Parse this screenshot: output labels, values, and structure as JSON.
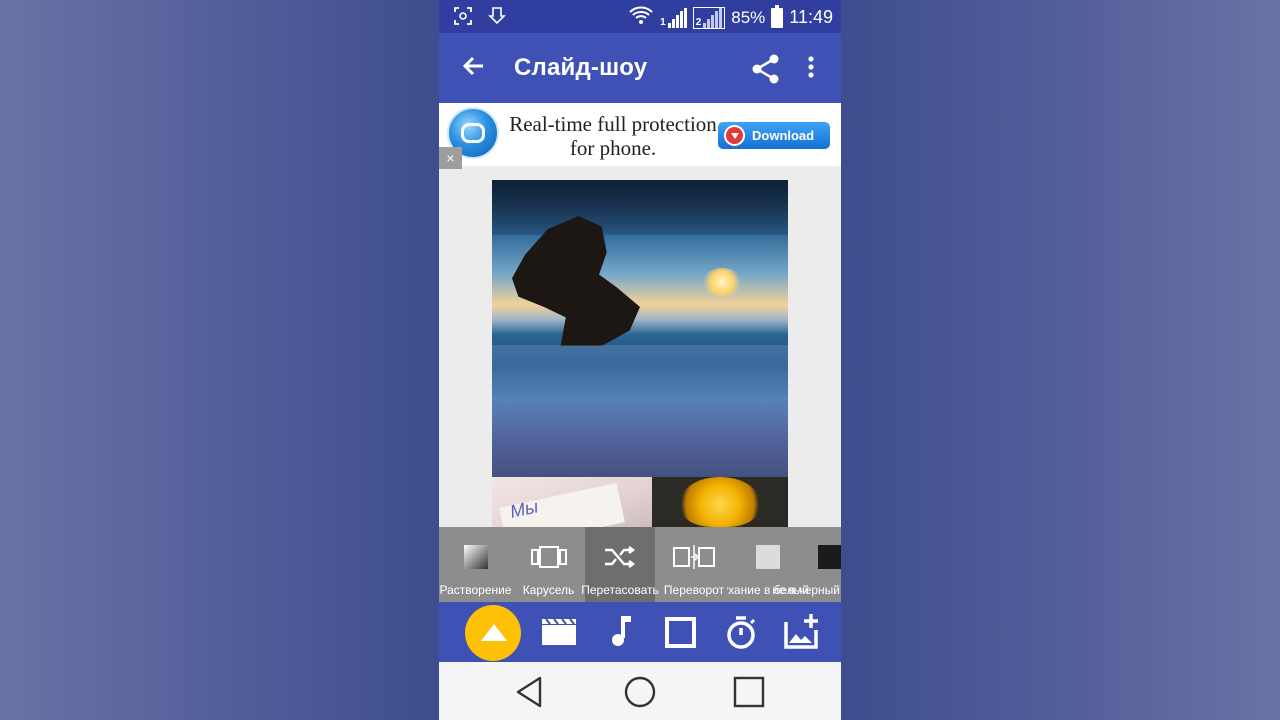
{
  "status_bar": {
    "time": "11:49",
    "battery_percent": "85%",
    "sim1_label": "1",
    "sim2_label": "2",
    "icons": [
      "screenshot-icon",
      "download-icon",
      "wifi-icon",
      "signal-sim1-icon",
      "signal-sim2-icon",
      "battery-icon"
    ]
  },
  "app_bar": {
    "title": "Слайд-шоу",
    "icons": [
      "back-arrow-icon",
      "share-icon",
      "more-vert-icon"
    ]
  },
  "ad": {
    "text": "Real-time full protection for phone.",
    "button_label": "Download",
    "close_label": "×"
  },
  "preview": {
    "second_photo_text": "Мы"
  },
  "transitions": {
    "selected_index": 2,
    "items": [
      {
        "label": "Растворение",
        "icon": "fade-gradient-icon"
      },
      {
        "label": "Карусель",
        "icon": "carousel-icon"
      },
      {
        "label": "Перетасовать",
        "icon": "shuffle-icon"
      },
      {
        "label": "Переворот",
        "icon": "flip-icon"
      },
      {
        "label": "Затухание в белый",
        "icon": "fade-white-icon"
      },
      {
        "label": "Затухание в черный",
        "icon": "fade-black-icon"
      }
    ]
  },
  "toolbar": {
    "items": [
      "theme-icon",
      "movie-clapper-icon",
      "music-note-icon",
      "frame-icon",
      "timer-icon",
      "add-photo-icon"
    ],
    "active_color": "#ffc107",
    "bar_color": "#3f51b5"
  },
  "nav_bar": {
    "items": [
      "nav-back-icon",
      "nav-home-icon",
      "nav-recents-icon"
    ]
  },
  "colors": {
    "status_bar": "#303f9f",
    "app_bar": "#3f51b5",
    "ad_button": "#1e88e5"
  }
}
